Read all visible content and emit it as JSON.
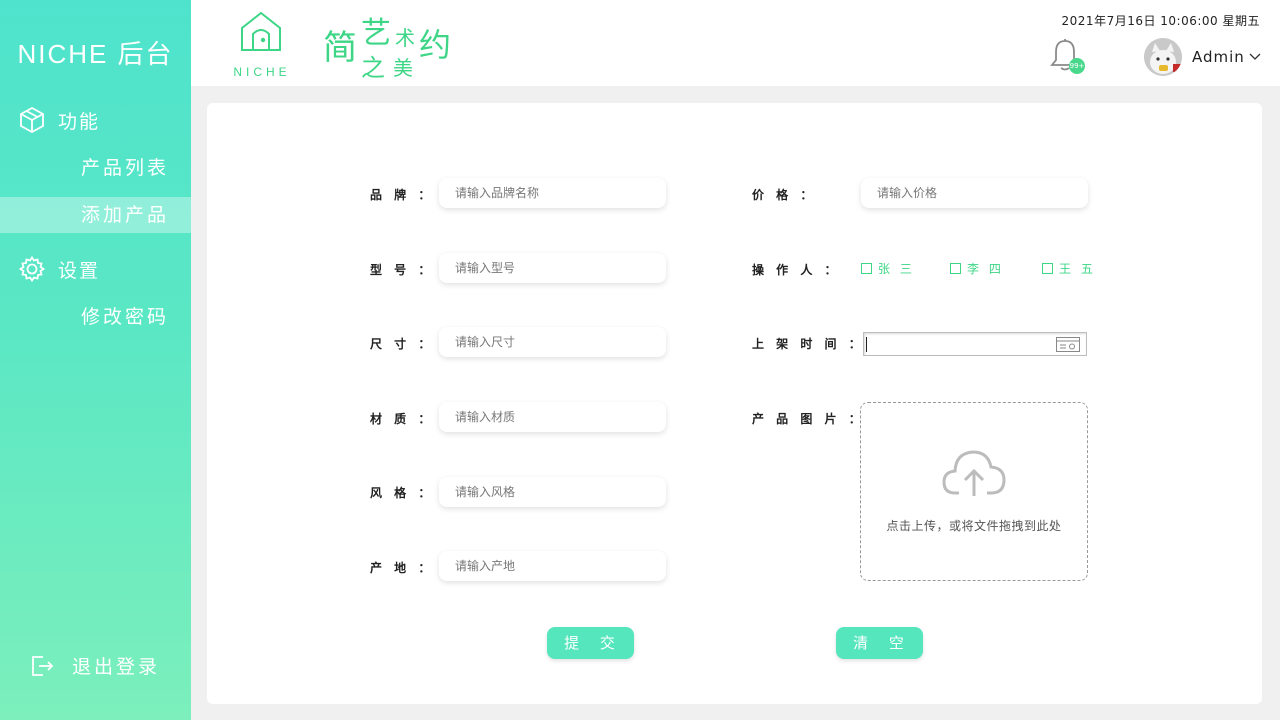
{
  "sidebar": {
    "brand": "NICHE 后台",
    "sections": [
      {
        "label": "功能",
        "icon": "cube-icon"
      },
      {
        "label": "设置",
        "icon": "gear-icon"
      }
    ],
    "items": {
      "product_list": "产品列表",
      "add_product": "添加产品",
      "change_password": "修改密码"
    },
    "logout": "退出登录"
  },
  "header": {
    "logo_text": "NICHE",
    "slogan": {
      "c1": "简",
      "c2": "艺",
      "c3": "术",
      "c4": "约",
      "c5": "之",
      "c6": "美"
    },
    "datetime": "2021年7月16日  10:06:00   星期五",
    "badge": "99+",
    "user": "Admin"
  },
  "form": {
    "brand": {
      "label": "品 牌 ：",
      "placeholder": "请输入品牌名称"
    },
    "model": {
      "label": "型 号 ：",
      "placeholder": "请输入型号"
    },
    "size": {
      "label": "尺 寸 ：",
      "placeholder": "请输入尺寸"
    },
    "material": {
      "label": "材 质 ：",
      "placeholder": "请输入材质"
    },
    "style": {
      "label": "风 格 ：",
      "placeholder": "请输入风格"
    },
    "origin": {
      "label": "产 地 ：",
      "placeholder": "请输入产地"
    },
    "price": {
      "label": "价 格 ：",
      "placeholder": "请输入价格"
    },
    "operator": {
      "label": "操 作 人 ：",
      "options": [
        "张 三",
        "李 四",
        "王 五"
      ]
    },
    "shelf_time": {
      "label": "上 架 时 间 ："
    },
    "image": {
      "label": "产 品 图 片 ：",
      "hint": "点击上传，或将文件拖拽到此处"
    },
    "submit": "提 交",
    "clear": "清 空"
  },
  "colors": {
    "accent": "#55e6be",
    "brand_green": "#3dd686"
  }
}
